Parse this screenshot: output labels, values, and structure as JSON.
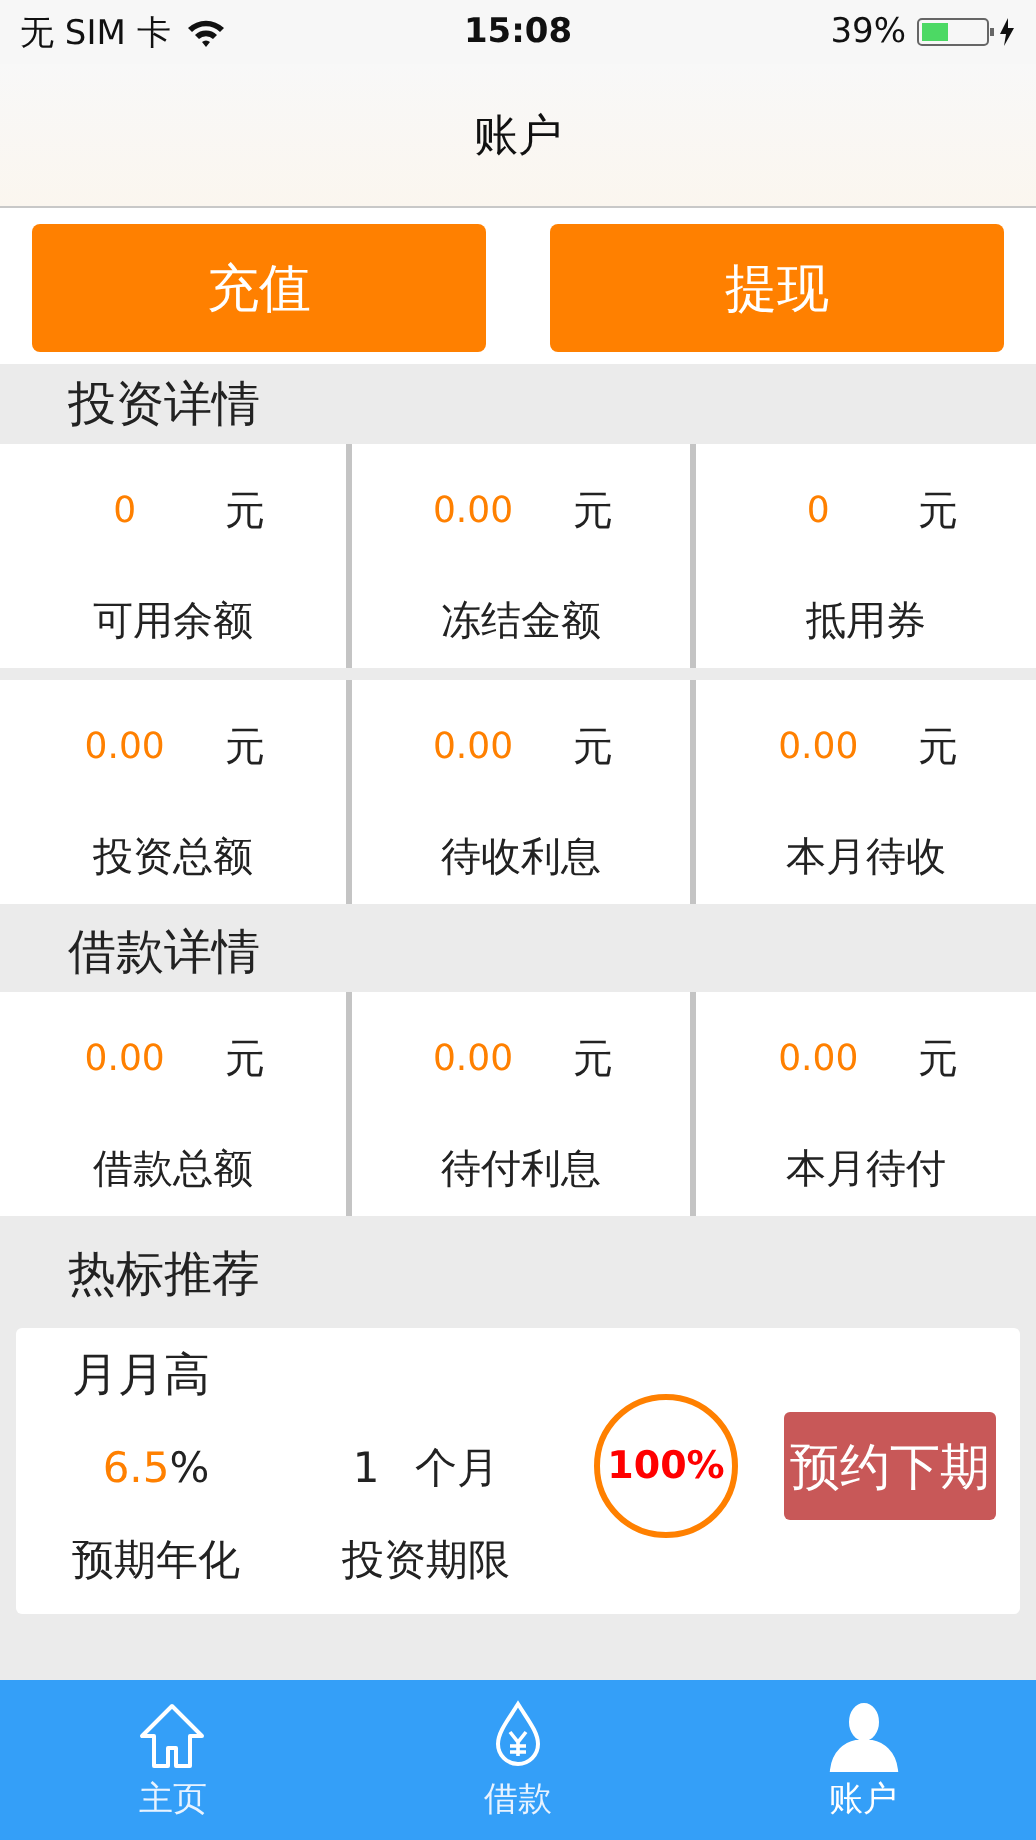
{
  "status_bar": {
    "carrier": "无 SIM 卡",
    "time": "15:08",
    "battery": "39%"
  },
  "title": "账户",
  "actions": [
    "充值",
    "提现"
  ],
  "sections": [
    {
      "title": "投资详情",
      "rows": [
        [
          {
            "value": "0",
            "unit": "元",
            "label": "可用余额"
          },
          {
            "value": "0.00",
            "unit": "元",
            "label": "冻结金额"
          },
          {
            "value": "0",
            "unit": "元",
            "label": "抵用券"
          }
        ],
        [
          {
            "value": "0.00",
            "unit": "元",
            "label": "投资总额"
          },
          {
            "value": "0.00",
            "unit": "元",
            "label": "待收利息"
          },
          {
            "value": "0.00",
            "unit": "元",
            "label": "本月待收"
          }
        ]
      ]
    },
    {
      "title": "借款详情",
      "rows": [
        [
          {
            "value": "0.00",
            "unit": "元",
            "label": "借款总额"
          },
          {
            "value": "0.00",
            "unit": "元",
            "label": "待付利息"
          },
          {
            "value": "0.00",
            "unit": "元",
            "label": "本月待付"
          }
        ]
      ]
    }
  ],
  "recommend": {
    "title": "热标推荐",
    "product": {
      "name": "月月高",
      "rate": "6.5",
      "rate_unit": "%",
      "rate_label": "预期年化",
      "term": "1",
      "term_unit": "个月",
      "term_label": "投资期限",
      "progress": "100%",
      "button": "预约下期"
    }
  },
  "tabs": [
    {
      "label": "主页",
      "kind": "home",
      "selected": false
    },
    {
      "label": "借款",
      "kind": "loan",
      "selected": false
    },
    {
      "label": "账户",
      "kind": "account",
      "selected": true
    }
  ]
}
